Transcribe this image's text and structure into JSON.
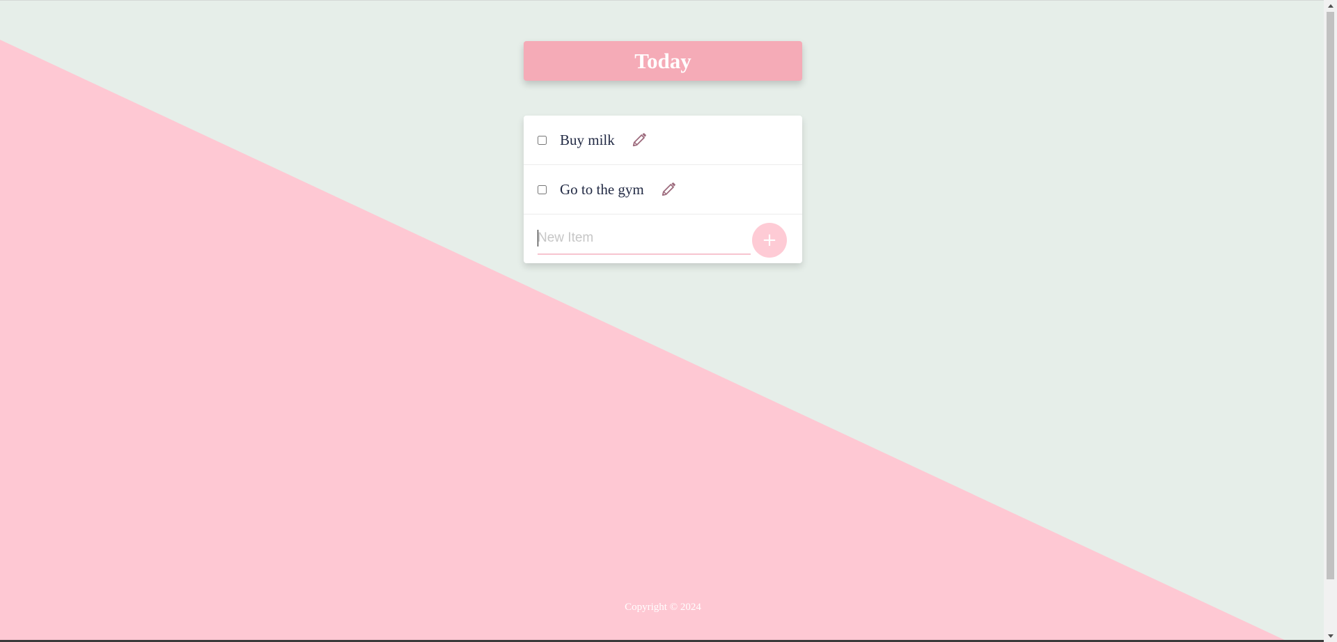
{
  "header": {
    "title": "Today"
  },
  "items": [
    {
      "label": "Buy milk",
      "checked": false
    },
    {
      "label": "Go to the gym",
      "checked": false
    }
  ],
  "new_item": {
    "value": "",
    "placeholder": "New Item",
    "add_label": "+"
  },
  "footer": {
    "copyright": "Copyright © 2024"
  },
  "colors": {
    "background": "#e6eee9",
    "accent_triangle": "#fec8d3",
    "heading": "#f5abb7",
    "add_button": "#fecbd5",
    "edit_icon": "#9d6b7d"
  },
  "icons": {
    "edit": "pencil-icon",
    "add": "plus-icon"
  }
}
